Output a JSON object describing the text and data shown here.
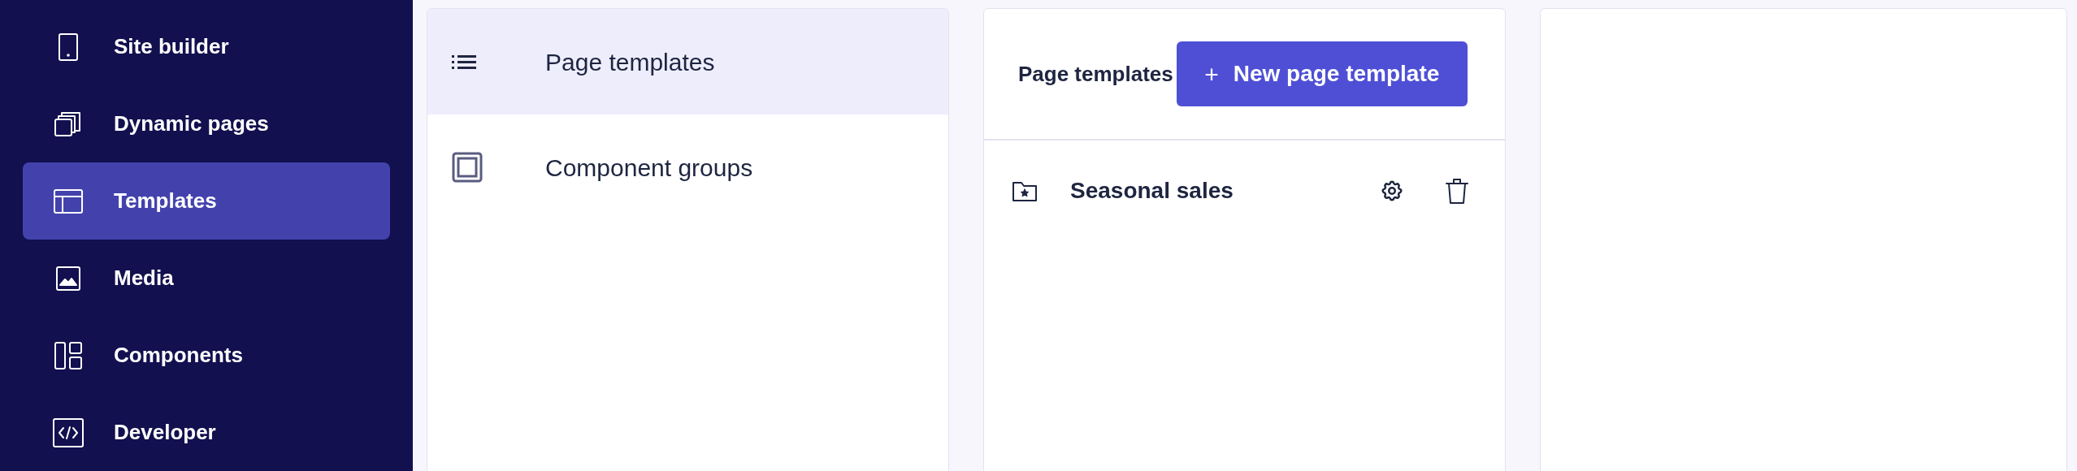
{
  "sidebar": {
    "items": [
      {
        "label": "Site builder",
        "selected": false
      },
      {
        "label": "Dynamic pages",
        "selected": false
      },
      {
        "label": "Templates",
        "selected": true
      },
      {
        "label": "Media",
        "selected": false
      },
      {
        "label": "Components",
        "selected": false
      },
      {
        "label": "Developer",
        "selected": false
      }
    ]
  },
  "template_types": {
    "items": [
      {
        "label": "Page templates",
        "selected": true
      },
      {
        "label": "Component groups",
        "selected": false
      }
    ]
  },
  "templates_panel": {
    "title": "Page templates",
    "new_button": {
      "icon": "+",
      "label": "New page template"
    },
    "folders": [
      {
        "name": "Seasonal sales"
      }
    ]
  }
}
